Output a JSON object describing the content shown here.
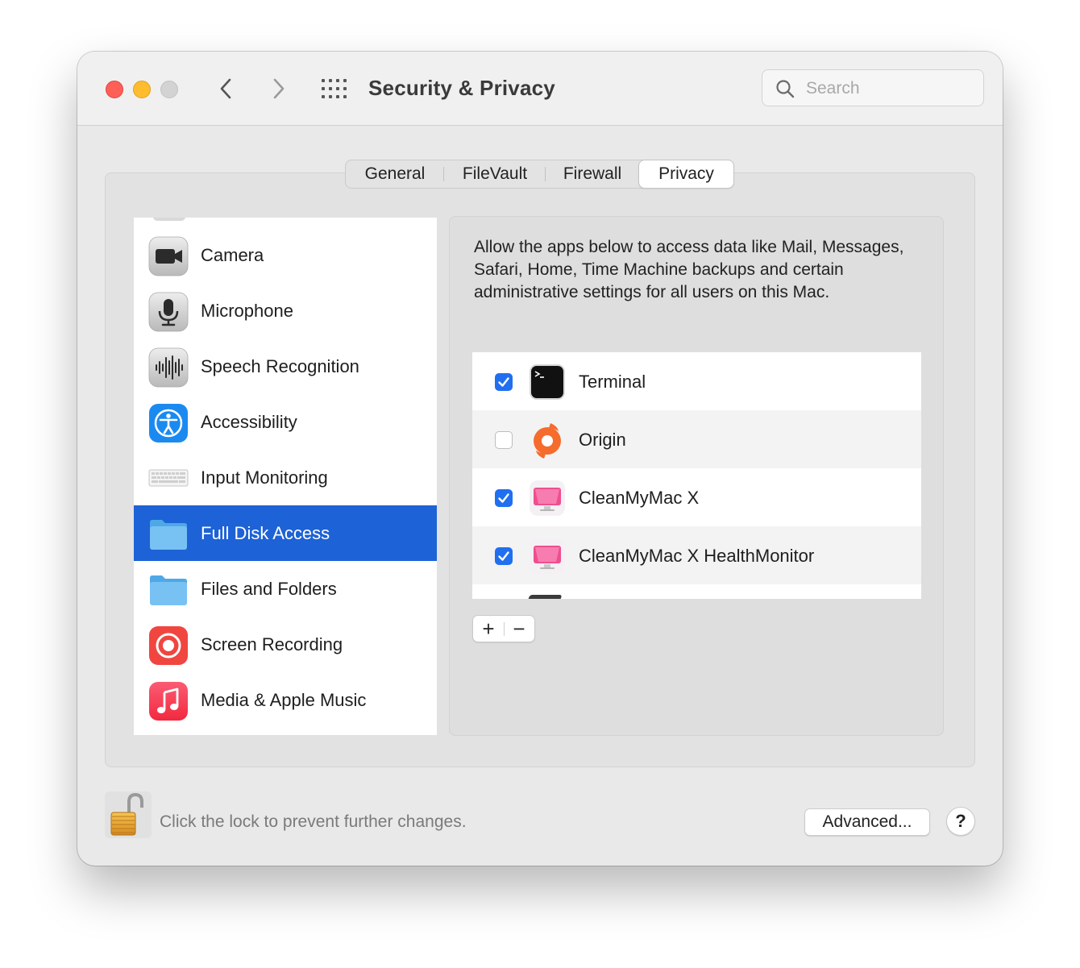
{
  "window": {
    "title": "Security & Privacy"
  },
  "toolbar": {
    "back_icon": "chevron-left-icon",
    "forward_icon": "chevron-right-icon",
    "grid_icon": "show-all-grid-icon"
  },
  "search": {
    "placeholder": "Search",
    "value": ""
  },
  "tabs": [
    {
      "label": "General",
      "active": false
    },
    {
      "label": "FileVault",
      "active": false
    },
    {
      "label": "Firewall",
      "active": false
    },
    {
      "label": "Privacy",
      "active": true
    }
  ],
  "sidebar": {
    "items": [
      {
        "label": "Camera",
        "icon": "camera-icon",
        "selected": false
      },
      {
        "label": "Microphone",
        "icon": "microphone-icon",
        "selected": false
      },
      {
        "label": "Speech Recognition",
        "icon": "speech-recognition-icon",
        "selected": false
      },
      {
        "label": "Accessibility",
        "icon": "accessibility-icon",
        "selected": false
      },
      {
        "label": "Input Monitoring",
        "icon": "keyboard-icon",
        "selected": false
      },
      {
        "label": "Full Disk Access",
        "icon": "folder-icon",
        "selected": true
      },
      {
        "label": "Files and Folders",
        "icon": "folder-icon",
        "selected": false
      },
      {
        "label": "Screen Recording",
        "icon": "screen-recording-icon",
        "selected": false
      },
      {
        "label": "Media & Apple Music",
        "icon": "music-note-icon",
        "selected": false
      }
    ]
  },
  "panel": {
    "description": "Allow the apps below to access data like Mail, Messages, Safari, Home, Time Machine backups and certain administrative settings for all users on this Mac.",
    "apps": [
      {
        "name": "Terminal",
        "checked": true,
        "icon": "terminal-icon"
      },
      {
        "name": "Origin",
        "checked": false,
        "icon": "origin-icon"
      },
      {
        "name": "CleanMyMac X",
        "checked": true,
        "icon": "cleanmymac-icon"
      },
      {
        "name": "CleanMyMac X HealthMonitor",
        "checked": true,
        "icon": "cleanmymac-icon"
      }
    ],
    "add_label": "+",
    "remove_label": "−"
  },
  "footer": {
    "lock_text": "Click the lock to prevent further changes.",
    "advanced_label": "Advanced...",
    "help_label": "?"
  },
  "colors": {
    "selection": "#1d62d6",
    "checkbox_on": "#1f6ff0",
    "close": "#fe5f57",
    "minimize": "#febc2e"
  }
}
